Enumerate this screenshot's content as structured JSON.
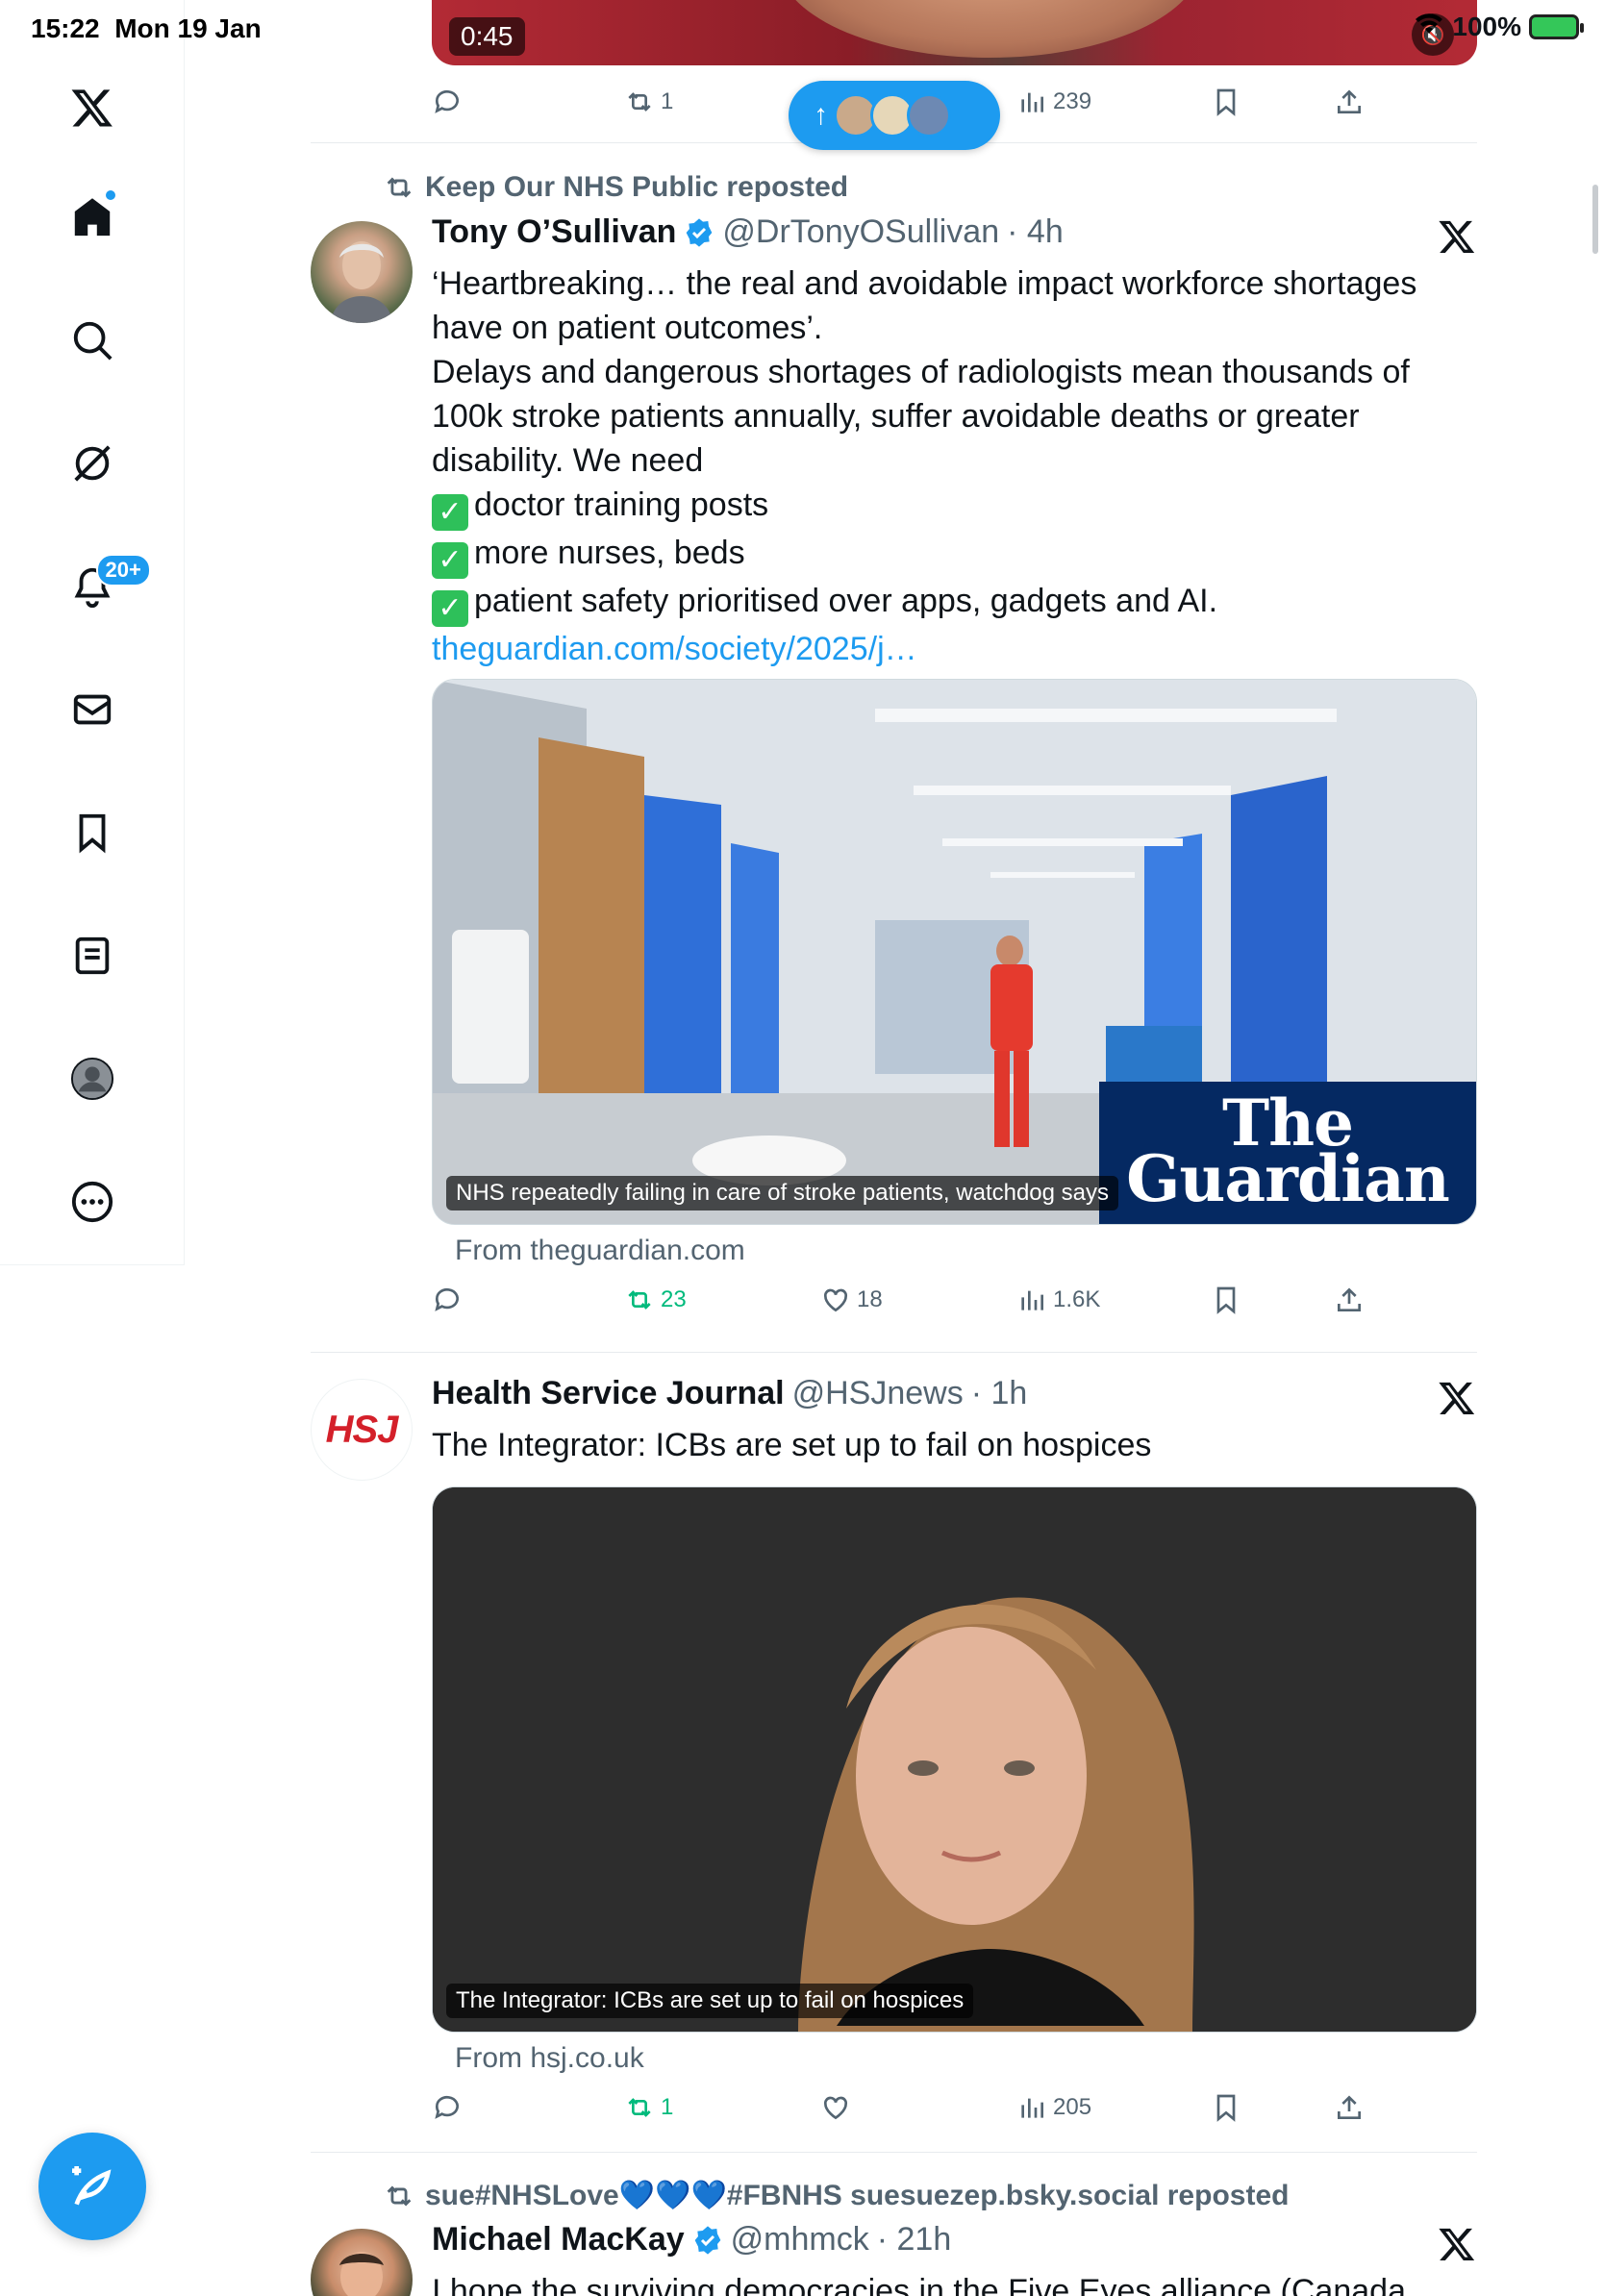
{
  "status_bar": {
    "time": "15:22",
    "date": "Mon 19 Jan",
    "battery": "100%"
  },
  "sidebar": {
    "items": [
      {
        "name": "home",
        "label": "Home"
      },
      {
        "name": "search",
        "label": "Explore"
      },
      {
        "name": "grok",
        "label": "Grok"
      },
      {
        "name": "notifications",
        "label": "Notifications",
        "badge": "20+"
      },
      {
        "name": "messages",
        "label": "Messages"
      },
      {
        "name": "bookmarks",
        "label": "Bookmarks"
      },
      {
        "name": "lists",
        "label": "Lists"
      },
      {
        "name": "profile",
        "label": "Profile"
      },
      {
        "name": "more",
        "label": "More"
      }
    ]
  },
  "top_tweet": {
    "video_time": "0:45",
    "reposts": "1",
    "views": "239"
  },
  "tweets": [
    {
      "reposted_by": "Keep Our NHS Public reposted",
      "name": "Tony O’Sullivan",
      "handle": "@DrTonyOSullivan",
      "time": "· 4h",
      "text_lines": [
        "‘Heartbreaking… the real and avoidable impact workforce shortages",
        "have on patient outcomes’.",
        "Delays and dangerous shortages of radiologists mean thousands of",
        "100k stroke patients annually, suffer avoidable deaths or greater",
        "disability. We need"
      ],
      "checklist": [
        "doctor training posts",
        "more nurses, beds",
        "patient safety prioritised over apps, gadgets and AI."
      ],
      "link": "theguardian.com/society/2025/j…",
      "card_caption": "NHS repeatedly failing in care of stroke patients, watchdog says",
      "card_logo_line1": "The",
      "card_logo_line2": "Guardian",
      "card_from": "From theguardian.com",
      "replies": "",
      "reposts": "23",
      "likes": "18",
      "views": "1.6K"
    },
    {
      "name": "Health Service Journal",
      "handle": "@HSJnews",
      "time": "· 1h",
      "avatar_text": "HSJ",
      "text": "The Integrator: ICBs are set up to fail on hospices",
      "card_caption": "The Integrator: ICBs are set up to fail on hospices",
      "card_from": "From hsj.co.uk",
      "reposts": "1",
      "views": "205"
    },
    {
      "reposted_by": "sue#NHSLove💙💙💙#FBNHS suesuezep.bsky.social reposted",
      "name": "Michael MacKay",
      "handle": "@mhmck",
      "time": "· 21h",
      "text": "I hope the surviving democracies in the Five Eyes alliance (Canada, the"
    }
  ],
  "colors": {
    "accent": "#1d9bf0",
    "repost_green": "#00ba7c",
    "muted": "#536471",
    "guardian_blue": "#052962",
    "hsj_red": "#d4202a"
  }
}
